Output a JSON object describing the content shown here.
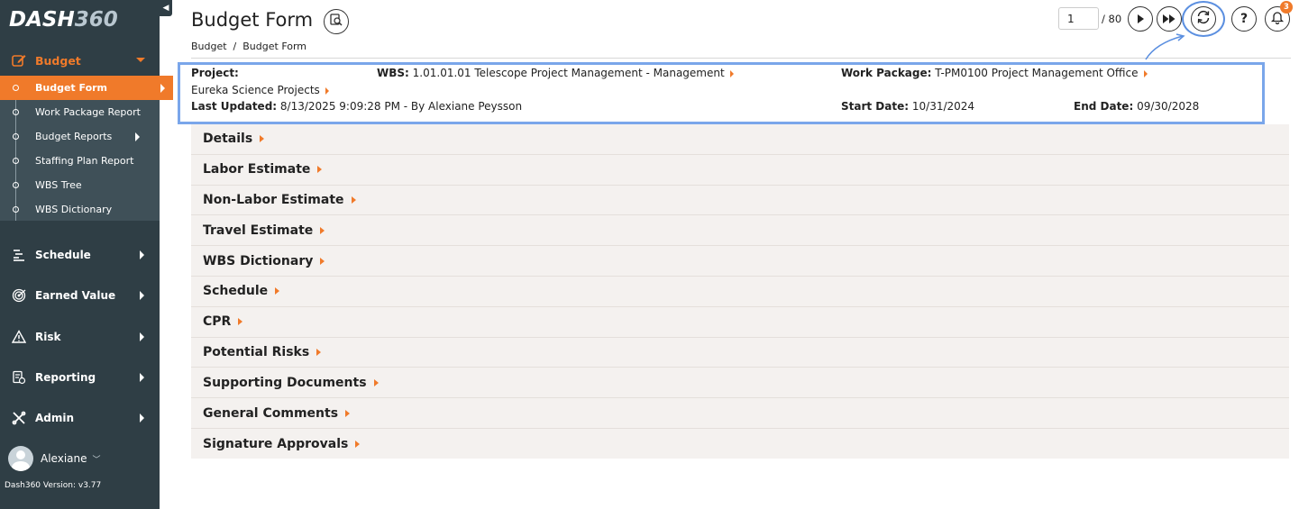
{
  "app": {
    "logo_left": "DASH",
    "logo_right": "360",
    "version": "Dash360 Version: v3.77"
  },
  "sidebar": {
    "budget_label": "Budget",
    "sub_items": [
      {
        "label": "Budget Form",
        "active": true,
        "has_arrow": true
      },
      {
        "label": "Work Package Report",
        "active": false,
        "has_arrow": false
      },
      {
        "label": "Budget Reports",
        "active": false,
        "has_arrow": true
      },
      {
        "label": "Staffing Plan Report",
        "active": false,
        "has_arrow": false
      },
      {
        "label": "WBS Tree",
        "active": false,
        "has_arrow": false
      },
      {
        "label": "WBS Dictionary",
        "active": false,
        "has_arrow": false
      }
    ],
    "main_items": [
      {
        "label": "Schedule",
        "icon": "schedule-icon"
      },
      {
        "label": "Earned Value",
        "icon": "target-icon"
      },
      {
        "label": "Risk",
        "icon": "warning-icon"
      },
      {
        "label": "Reporting",
        "icon": "report-icon"
      },
      {
        "label": "Admin",
        "icon": "tools-icon"
      }
    ],
    "user_name": "Alexiane"
  },
  "header": {
    "title": "Budget Form",
    "breadcrumb": "Budget  /  Budget Form",
    "page_value": "1",
    "page_total": "/ 80",
    "notification_count": "3"
  },
  "info": {
    "project_label": "Project:",
    "project_value": "Eureka Science Projects",
    "wbs_label": "WBS:",
    "wbs_value": "1.01.01.01 Telescope Project Management - Management",
    "work_package_label": "Work Package:",
    "work_package_value": "T-PM0100 Project Management Office",
    "last_updated_label": "Last Updated:",
    "last_updated_value": "8/13/2025 9:09:28 PM - By Alexiane Peysson",
    "start_date_label": "Start Date:",
    "start_date_value": "10/31/2024",
    "end_date_label": "End Date:",
    "end_date_value": "09/30/2028"
  },
  "sections": [
    "Details",
    "Labor Estimate",
    "Non-Labor Estimate",
    "Travel Estimate",
    "WBS Dictionary",
    "Schedule",
    "CPR",
    "Potential Risks",
    "Supporting Documents",
    "General Comments",
    "Signature Approvals"
  ],
  "colors": {
    "sidebar_bg": "#2f3e45",
    "accent": "#f07a2a",
    "highlight": "#7aa6ea",
    "section_bg": "#f4f1ef"
  }
}
